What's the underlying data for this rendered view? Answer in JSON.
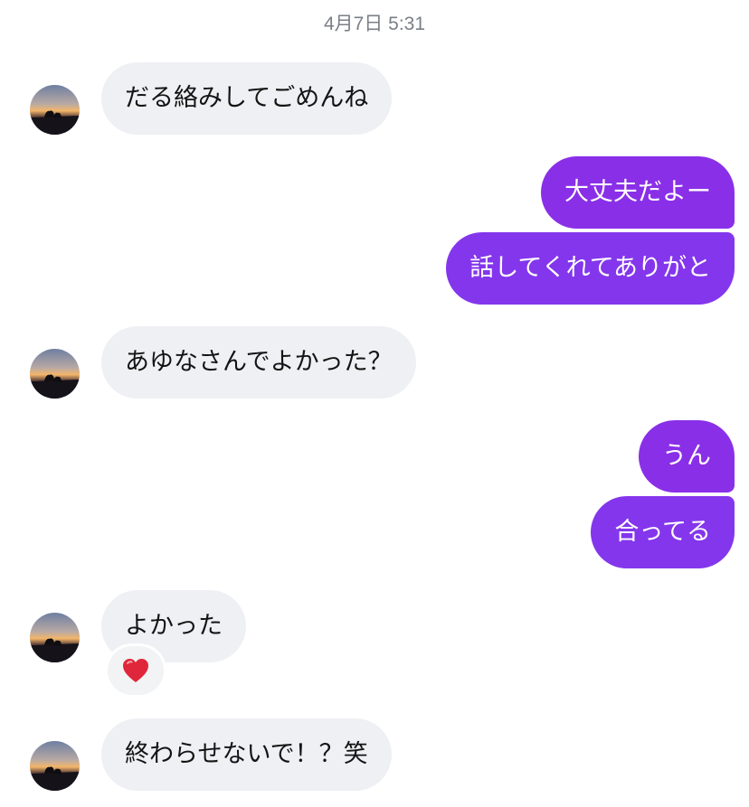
{
  "conversation": {
    "date_label": "4月7日 5:31",
    "messages": [
      {
        "sender": "other",
        "text": "だる絡みしてごめんね"
      },
      {
        "sender": "me",
        "text": "大丈夫だよー"
      },
      {
        "sender": "me",
        "text": "話してくれてありがと"
      },
      {
        "sender": "other",
        "text": "あゆなさんでよかった？"
      },
      {
        "sender": "me",
        "text": "うん"
      },
      {
        "sender": "me",
        "text": "合ってる"
      },
      {
        "sender": "other",
        "text": "よかった",
        "reaction": "heart-icon"
      },
      {
        "sender": "other",
        "text": "終わらせないで！？笑"
      }
    ]
  },
  "colors": {
    "outgoing_bubble": "#8b2fe6",
    "incoming_bubble": "#eef0f3",
    "reaction_heart": "#e0263a",
    "timestamp_text": "#7a7f86"
  }
}
